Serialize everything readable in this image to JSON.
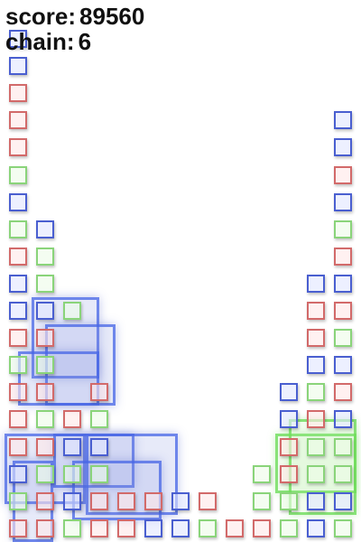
{
  "hud": {
    "score_label": "score:",
    "score_value": "89560",
    "chain_label": "chain:",
    "chain_value": "6"
  },
  "colors": {
    "blue": "#4a5fd0",
    "red": "#d26a6a",
    "green": "#8ad47a",
    "background": "#ffffff"
  },
  "board": {
    "columns": 13,
    "rows": 19,
    "cells": [
      {
        "col": 0,
        "row": 0,
        "color": "blue"
      },
      {
        "col": 0,
        "row": 1,
        "color": "blue"
      },
      {
        "col": 0,
        "row": 2,
        "color": "red"
      },
      {
        "col": 0,
        "row": 3,
        "color": "red"
      },
      {
        "col": 0,
        "row": 4,
        "color": "red"
      },
      {
        "col": 0,
        "row": 5,
        "color": "green"
      },
      {
        "col": 0,
        "row": 6,
        "color": "blue"
      },
      {
        "col": 0,
        "row": 7,
        "color": "green"
      },
      {
        "col": 0,
        "row": 8,
        "color": "red"
      },
      {
        "col": 0,
        "row": 9,
        "color": "blue"
      },
      {
        "col": 0,
        "row": 10,
        "color": "blue"
      },
      {
        "col": 0,
        "row": 11,
        "color": "red"
      },
      {
        "col": 0,
        "row": 12,
        "color": "green"
      },
      {
        "col": 0,
        "row": 13,
        "color": "red"
      },
      {
        "col": 0,
        "row": 14,
        "color": "red"
      },
      {
        "col": 0,
        "row": 15,
        "color": "red"
      },
      {
        "col": 0,
        "row": 16,
        "color": "blue"
      },
      {
        "col": 0,
        "row": 17,
        "color": "green"
      },
      {
        "col": 0,
        "row": 18,
        "color": "red"
      },
      {
        "col": 1,
        "row": 7,
        "color": "blue"
      },
      {
        "col": 1,
        "row": 8,
        "color": "green"
      },
      {
        "col": 1,
        "row": 9,
        "color": "green"
      },
      {
        "col": 1,
        "row": 10,
        "color": "blue"
      },
      {
        "col": 1,
        "row": 11,
        "color": "red"
      },
      {
        "col": 1,
        "row": 12,
        "color": "green"
      },
      {
        "col": 1,
        "row": 13,
        "color": "red"
      },
      {
        "col": 1,
        "row": 14,
        "color": "green"
      },
      {
        "col": 1,
        "row": 15,
        "color": "red"
      },
      {
        "col": 1,
        "row": 16,
        "color": "green"
      },
      {
        "col": 1,
        "row": 17,
        "color": "red"
      },
      {
        "col": 1,
        "row": 18,
        "color": "red"
      },
      {
        "col": 2,
        "row": 10,
        "color": "green"
      },
      {
        "col": 2,
        "row": 14,
        "color": "red"
      },
      {
        "col": 2,
        "row": 15,
        "color": "blue"
      },
      {
        "col": 2,
        "row": 16,
        "color": "green"
      },
      {
        "col": 2,
        "row": 17,
        "color": "blue"
      },
      {
        "col": 2,
        "row": 18,
        "color": "green"
      },
      {
        "col": 3,
        "row": 13,
        "color": "red"
      },
      {
        "col": 3,
        "row": 14,
        "color": "green"
      },
      {
        "col": 3,
        "row": 15,
        "color": "blue"
      },
      {
        "col": 3,
        "row": 16,
        "color": "green"
      },
      {
        "col": 3,
        "row": 17,
        "color": "red"
      },
      {
        "col": 3,
        "row": 18,
        "color": "red"
      },
      {
        "col": 4,
        "row": 17,
        "color": "red"
      },
      {
        "col": 4,
        "row": 18,
        "color": "red"
      },
      {
        "col": 5,
        "row": 17,
        "color": "red"
      },
      {
        "col": 5,
        "row": 18,
        "color": "blue"
      },
      {
        "col": 6,
        "row": 17,
        "color": "blue"
      },
      {
        "col": 6,
        "row": 18,
        "color": "blue"
      },
      {
        "col": 7,
        "row": 17,
        "color": "red"
      },
      {
        "col": 7,
        "row": 18,
        "color": "green"
      },
      {
        "col": 8,
        "row": 18,
        "color": "red"
      },
      {
        "col": 9,
        "row": 16,
        "color": "green"
      },
      {
        "col": 9,
        "row": 17,
        "color": "green"
      },
      {
        "col": 9,
        "row": 18,
        "color": "red"
      },
      {
        "col": 10,
        "row": 13,
        "color": "blue"
      },
      {
        "col": 10,
        "row": 14,
        "color": "blue"
      },
      {
        "col": 10,
        "row": 15,
        "color": "red"
      },
      {
        "col": 10,
        "row": 16,
        "color": "red"
      },
      {
        "col": 10,
        "row": 17,
        "color": "green"
      },
      {
        "col": 10,
        "row": 18,
        "color": "green"
      },
      {
        "col": 11,
        "row": 9,
        "color": "blue"
      },
      {
        "col": 11,
        "row": 10,
        "color": "red"
      },
      {
        "col": 11,
        "row": 11,
        "color": "red"
      },
      {
        "col": 11,
        "row": 12,
        "color": "blue"
      },
      {
        "col": 11,
        "row": 13,
        "color": "green"
      },
      {
        "col": 11,
        "row": 14,
        "color": "red"
      },
      {
        "col": 11,
        "row": 15,
        "color": "green"
      },
      {
        "col": 11,
        "row": 16,
        "color": "green"
      },
      {
        "col": 11,
        "row": 17,
        "color": "blue"
      },
      {
        "col": 11,
        "row": 18,
        "color": "blue"
      },
      {
        "col": 12,
        "row": 3,
        "color": "blue"
      },
      {
        "col": 12,
        "row": 4,
        "color": "blue"
      },
      {
        "col": 12,
        "row": 5,
        "color": "red"
      },
      {
        "col": 12,
        "row": 6,
        "color": "blue"
      },
      {
        "col": 12,
        "row": 7,
        "color": "green"
      },
      {
        "col": 12,
        "row": 8,
        "color": "red"
      },
      {
        "col": 12,
        "row": 9,
        "color": "blue"
      },
      {
        "col": 12,
        "row": 10,
        "color": "red"
      },
      {
        "col": 12,
        "row": 11,
        "color": "green"
      },
      {
        "col": 12,
        "row": 12,
        "color": "blue"
      },
      {
        "col": 12,
        "row": 13,
        "color": "red"
      },
      {
        "col": 12,
        "row": 14,
        "color": "blue"
      },
      {
        "col": 12,
        "row": 15,
        "color": "green"
      },
      {
        "col": 12,
        "row": 16,
        "color": "green"
      },
      {
        "col": 12,
        "row": 17,
        "color": "blue"
      },
      {
        "col": 12,
        "row": 18,
        "color": "green"
      }
    ],
    "blasts": [
      {
        "color": "blue",
        "col": 1,
        "row": 10,
        "w": 2.5,
        "h": 3
      },
      {
        "color": "blue",
        "col": 1.5,
        "row": 11,
        "w": 2.6,
        "h": 3
      },
      {
        "color": "blue",
        "col": 0.5,
        "row": 12,
        "w": 3,
        "h": 2
      },
      {
        "color": "blue",
        "col": 0,
        "row": 15,
        "w": 3,
        "h": 2.6
      },
      {
        "color": "blue",
        "col": 0.3,
        "row": 16,
        "w": 1.5,
        "h": 3
      },
      {
        "color": "blue",
        "col": 1.8,
        "row": 15,
        "w": 3,
        "h": 2
      },
      {
        "color": "blue",
        "col": 3,
        "row": 15,
        "w": 3.4,
        "h": 3
      },
      {
        "color": "blue",
        "col": 2.5,
        "row": 16,
        "w": 3.3,
        "h": 2.2
      },
      {
        "color": "green",
        "col": 10,
        "row": 15,
        "w": 3,
        "h": 2.2
      },
      {
        "color": "green",
        "col": 10.5,
        "row": 14.5,
        "w": 2.5,
        "h": 3.5
      }
    ]
  }
}
